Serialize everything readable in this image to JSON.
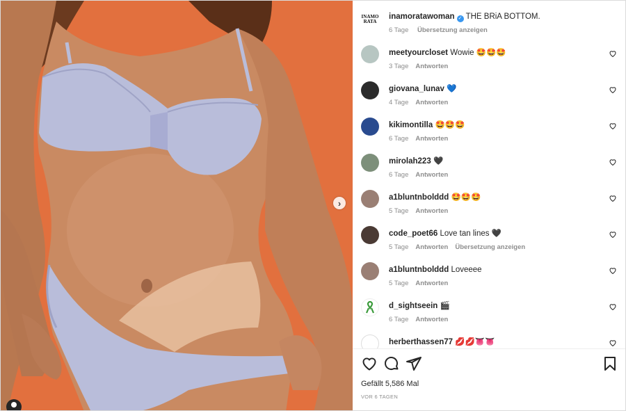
{
  "post": {
    "author": "inamoratawoman",
    "verified_mark": "✓",
    "caption": "THE BRiA BOTTOM.",
    "age": "6 Tage",
    "translate": "Übersetzung anzeigen",
    "logo_text_1": "INAMO",
    "logo_text_2": "RATA",
    "next_arrow": "›"
  },
  "comments": [
    {
      "user": "meetyourcloset",
      "text": "Wowie 🤩🤩🤩",
      "age": "3 Tage",
      "reply": "Antworten",
      "avatar_color": "#b7c6c2"
    },
    {
      "user": "giovana_lunav",
      "text": "💙",
      "age": "4 Tage",
      "reply": "Antworten",
      "avatar_color": "#2b2b2b"
    },
    {
      "user": "kikimontilla",
      "text": "🤩🤩🤩",
      "age": "6 Tage",
      "reply": "Antworten",
      "avatar_color": "#2a4b8f"
    },
    {
      "user": "mirolah223",
      "text": "🖤",
      "age": "6 Tage",
      "reply": "Antworten",
      "avatar_color": "#7d8f7a"
    },
    {
      "user": "a1bluntnbolddd",
      "text": "🤩🤩🤩",
      "age": "5 Tage",
      "reply": "Antworten",
      "avatar_color": "#9a7f74"
    },
    {
      "user": "code_poet66",
      "text": "Love tan lines 🖤",
      "age": "5 Tage",
      "reply": "Antworten",
      "translate": "Übersetzung anzeigen",
      "avatar_color": "#4a3a34"
    },
    {
      "user": "a1bluntnbolddd",
      "text": "Loveeee",
      "age": "5 Tage",
      "reply": "Antworten",
      "avatar_color": "#9a7f74"
    },
    {
      "user": "d_sightseein",
      "text": "🎬",
      "age": "6 Tage",
      "reply": "Antworten",
      "avatar_color": "#ffffff"
    },
    {
      "user": "herberthassen77",
      "text": "💋💋👅👅",
      "age": "",
      "reply": "",
      "avatar_color": "#d8d8d8"
    }
  ],
  "likes": "Gefällt 5,586 Mal",
  "timestamp": "VOR 6 TAGEN",
  "icons": {
    "like": "heart-icon",
    "comment": "comment-icon",
    "share": "share-icon",
    "save": "bookmark-icon",
    "tag": "user-tag-icon"
  },
  "colors": {
    "background_orange": "#e2703e",
    "swimsuit": "#b9bdda",
    "skin": "#c98a62",
    "verified": "#3897f0"
  }
}
